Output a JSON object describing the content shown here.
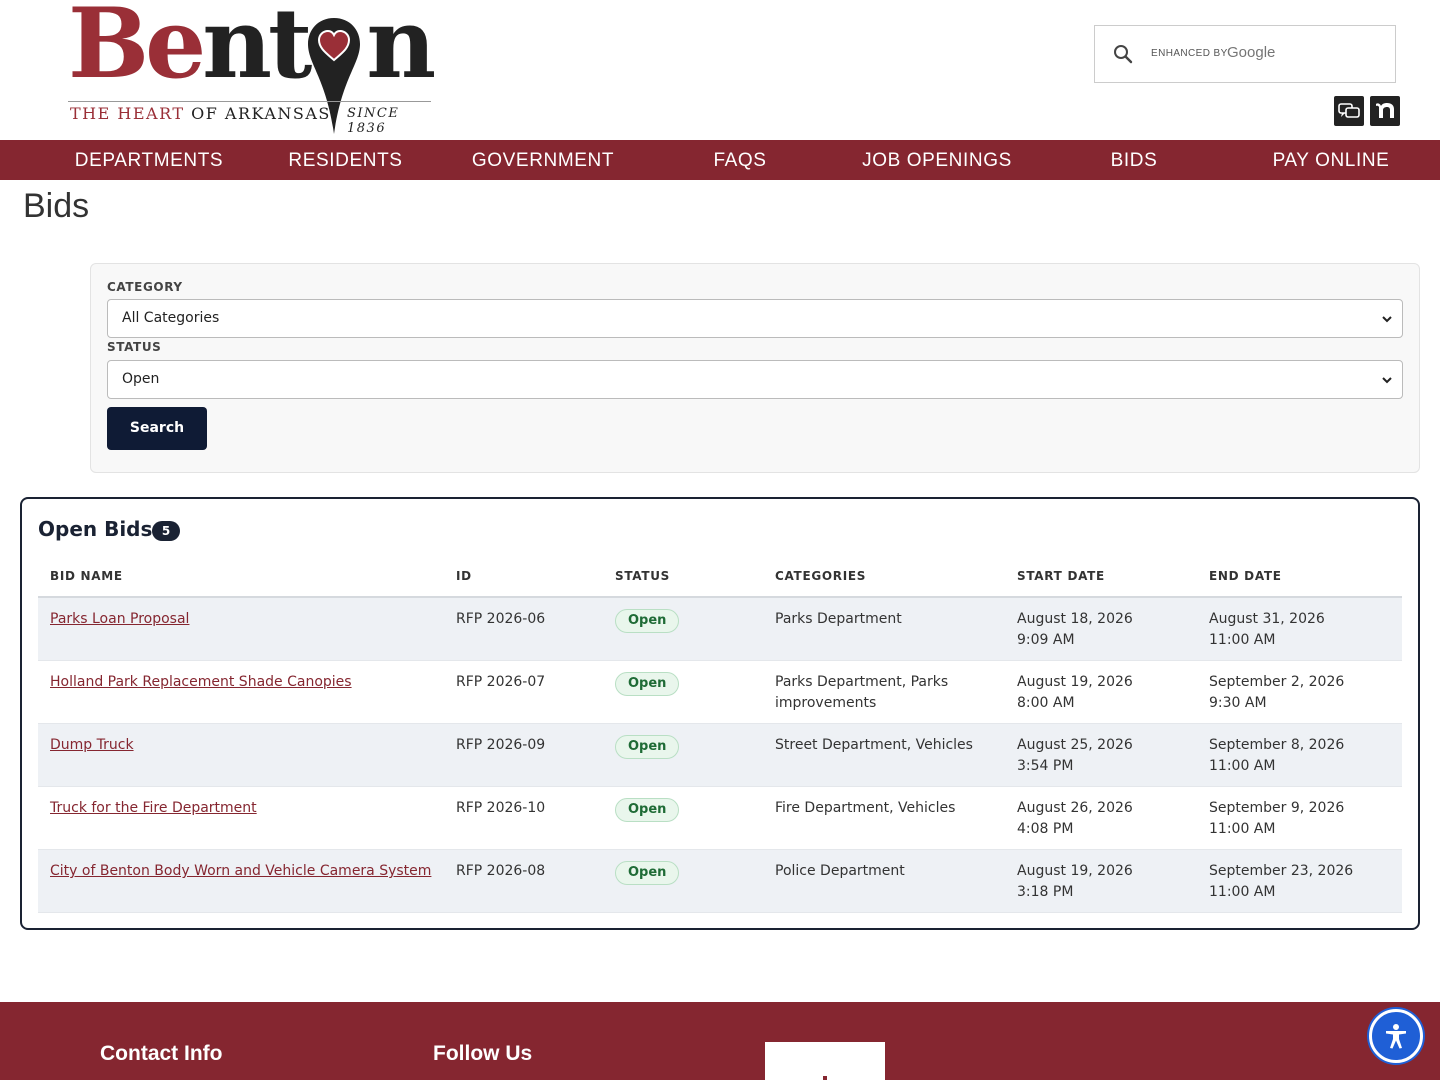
{
  "header": {
    "logo": {
      "word_part1": "Be",
      "word_part2": "nt",
      "word_part3": "n",
      "tagline_red": "THE HEART",
      "tagline_rest": " OF ARKANSAS",
      "since": "SINCE 1836"
    },
    "search": {
      "enhanced_by": "ENHANCED BY",
      "google": "Google",
      "icon": "search-icon"
    },
    "icons": [
      "chat-bubbles-icon",
      "nextdoor-icon"
    ]
  },
  "nav": {
    "items": [
      {
        "label": "DEPARTMENTS"
      },
      {
        "label": "RESIDENTS"
      },
      {
        "label": "GOVERNMENT"
      },
      {
        "label": "FAQS"
      },
      {
        "label": "JOB OPENINGS"
      },
      {
        "label": "BIDS"
      },
      {
        "label": "PAY ONLINE"
      }
    ],
    "background": "#852630"
  },
  "page": {
    "title": "Bids"
  },
  "filters": {
    "category_label": "CATEGORY",
    "category_value": "All Categories",
    "status_label": "STATUS",
    "status_value": "Open",
    "search_label": "Search"
  },
  "bids": {
    "title": "Open Bids",
    "count": "5",
    "columns": [
      "BID NAME",
      "ID",
      "STATUS",
      "CATEGORIES",
      "START DATE",
      "END DATE"
    ],
    "rows": [
      {
        "name": "Parks Loan Proposal",
        "id": "RFP 2026-06",
        "status": "Open",
        "categories_l1": "Parks Department",
        "categories_l2": "",
        "start_date": "August 18, 2026",
        "start_time": "9:09 AM",
        "end_date": "August 31, 2026",
        "end_time": "11:00 AM"
      },
      {
        "name": "Holland Park Replacement Shade Canopies",
        "id": "RFP 2026-07",
        "status": "Open",
        "categories_l1": "Parks Department, Parks",
        "categories_l2": "improvements",
        "start_date": "August 19, 2026",
        "start_time": "8:00 AM",
        "end_date": "September 2, 2026",
        "end_time": "9:30 AM"
      },
      {
        "name": "Dump Truck",
        "id": "RFP 2026-09",
        "status": "Open",
        "categories_l1": "Street Department, Vehicles",
        "categories_l2": "",
        "start_date": "August 25, 2026",
        "start_time": "3:54 PM",
        "end_date": "September 8, 2026",
        "end_time": "11:00 AM"
      },
      {
        "name": "Truck for the Fire Department",
        "id": "RFP 2026-10",
        "status": "Open",
        "categories_l1": "Fire Department, Vehicles",
        "categories_l2": "",
        "start_date": "August 26, 2026",
        "start_time": "4:08 PM",
        "end_date": "September 9, 2026",
        "end_time": "11:00 AM"
      },
      {
        "name": "City of Benton Body Worn and Vehicle Camera System",
        "id": "RFP 2026-08",
        "status": "Open",
        "categories_l1": "Police Department",
        "categories_l2": "",
        "start_date": "August 19, 2026",
        "start_time": "3:18 PM",
        "end_date": "September 23, 2026",
        "end_time": "11:00 AM"
      }
    ]
  },
  "footer": {
    "contact_heading": "Contact Info",
    "follow_heading": "Follow Us"
  },
  "accessibility_button": "accessibility-icon",
  "colors": {
    "brand_red": "#852630",
    "navy": "#0f1b35",
    "status_green": "#1f6b36"
  }
}
